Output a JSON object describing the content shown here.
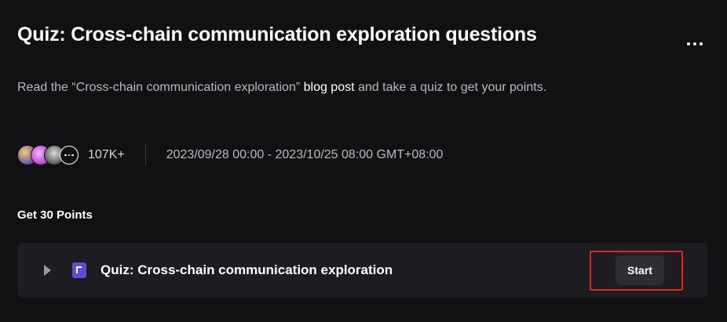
{
  "header": {
    "title": "Quiz: Cross-chain communication exploration questions",
    "more_icon": "more-horizontal-icon"
  },
  "description": {
    "before": "Read the “Cross-chain communication exploration” ",
    "link": "blog post",
    "after": " and take a quiz to get your points."
  },
  "meta": {
    "participants": "107K+",
    "date_range": "2023/09/28 00:00 - 2023/10/25 08:00 GMT+08:00"
  },
  "reward": {
    "label": "Get 30 Points"
  },
  "task": {
    "title": "Quiz: Cross-chain communication exploration",
    "start_label": "Start",
    "highlight_color": "#e8231f",
    "accent_color": "#5b4fd6"
  }
}
